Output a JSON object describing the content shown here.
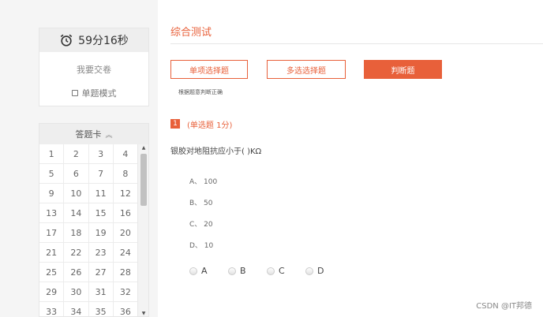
{
  "timer": {
    "icon": "alarm-clock-icon",
    "text": "59分16秒"
  },
  "sidebar": {
    "submit_label": "我要交卷",
    "single_mode_label": "单题模式"
  },
  "answer_card": {
    "title": "答题卡",
    "numbers": [
      "1",
      "2",
      "3",
      "4",
      "5",
      "6",
      "7",
      "8",
      "9",
      "10",
      "11",
      "12",
      "13",
      "14",
      "15",
      "16",
      "17",
      "18",
      "19",
      "20",
      "21",
      "22",
      "23",
      "24",
      "25",
      "26",
      "27",
      "28",
      "29",
      "30",
      "31",
      "32",
      "33",
      "34",
      "35",
      "36"
    ],
    "scroll_up": "▲",
    "scroll_down": "▼"
  },
  "page": {
    "title": "综合测试"
  },
  "tabs": [
    {
      "label": "单项选择题",
      "active": false
    },
    {
      "label": "多选选择题",
      "active": false
    },
    {
      "label": "判断题",
      "active": true
    }
  ],
  "hint": "根据题意判断正确",
  "question": {
    "number": "1",
    "type_label": "(单选题  1分)",
    "text": "银胶对地阻抗应小于( )KΩ",
    "options": [
      "A、 100",
      "B、 50",
      "C、 20",
      "D、 10"
    ],
    "choices": [
      "A",
      "B",
      "C",
      "D"
    ]
  },
  "watermark": "CSDN @IT邦德",
  "colors": {
    "accent": "#e8603a"
  }
}
